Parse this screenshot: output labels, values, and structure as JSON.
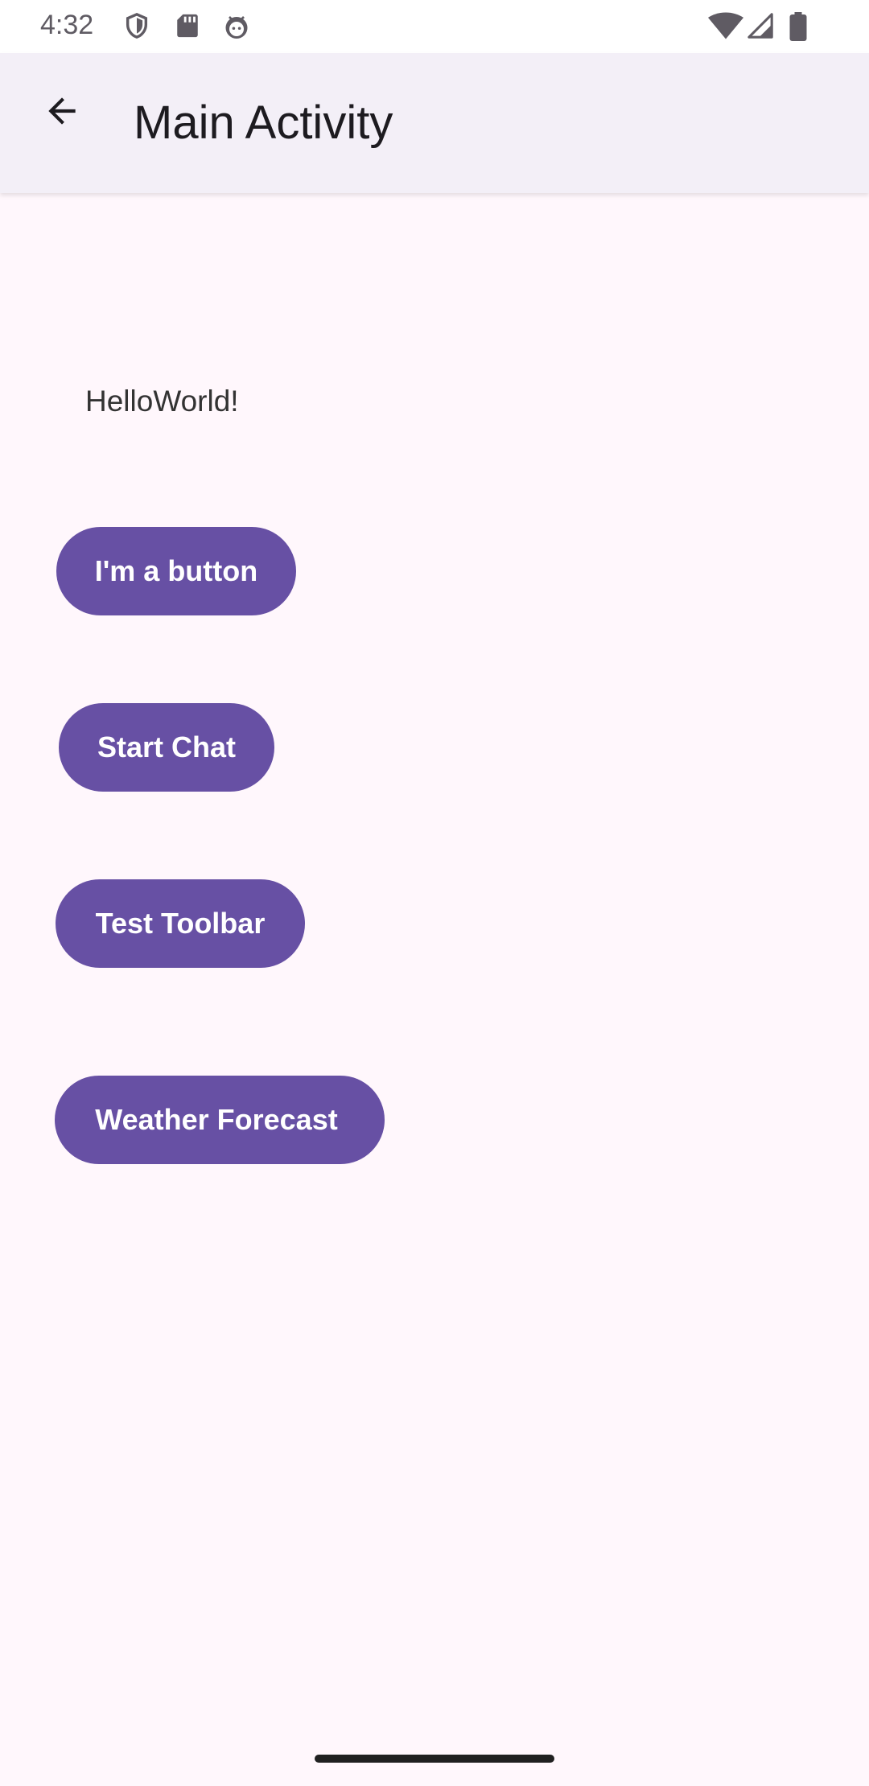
{
  "status_bar": {
    "time": "4:32",
    "left_icons": [
      "shield-icon",
      "sd-card-icon",
      "android-debug-icon"
    ],
    "right_icons": [
      "wifi-icon",
      "cellular-signal-icon",
      "battery-icon"
    ]
  },
  "app_bar": {
    "back_icon": "arrow-back-icon",
    "title": "Main Activity"
  },
  "main": {
    "hello_text": "HelloWorld!",
    "buttons": [
      {
        "label": "I'm a button"
      },
      {
        "label": "Start Chat"
      },
      {
        "label": "Test Toolbar"
      },
      {
        "label": "Weather Forecast"
      }
    ]
  },
  "colors": {
    "primary": "#6750A4",
    "app_bar_bg": "#F3EFF7",
    "background": "#FFF7FC",
    "on_primary": "#FFFFFF"
  }
}
